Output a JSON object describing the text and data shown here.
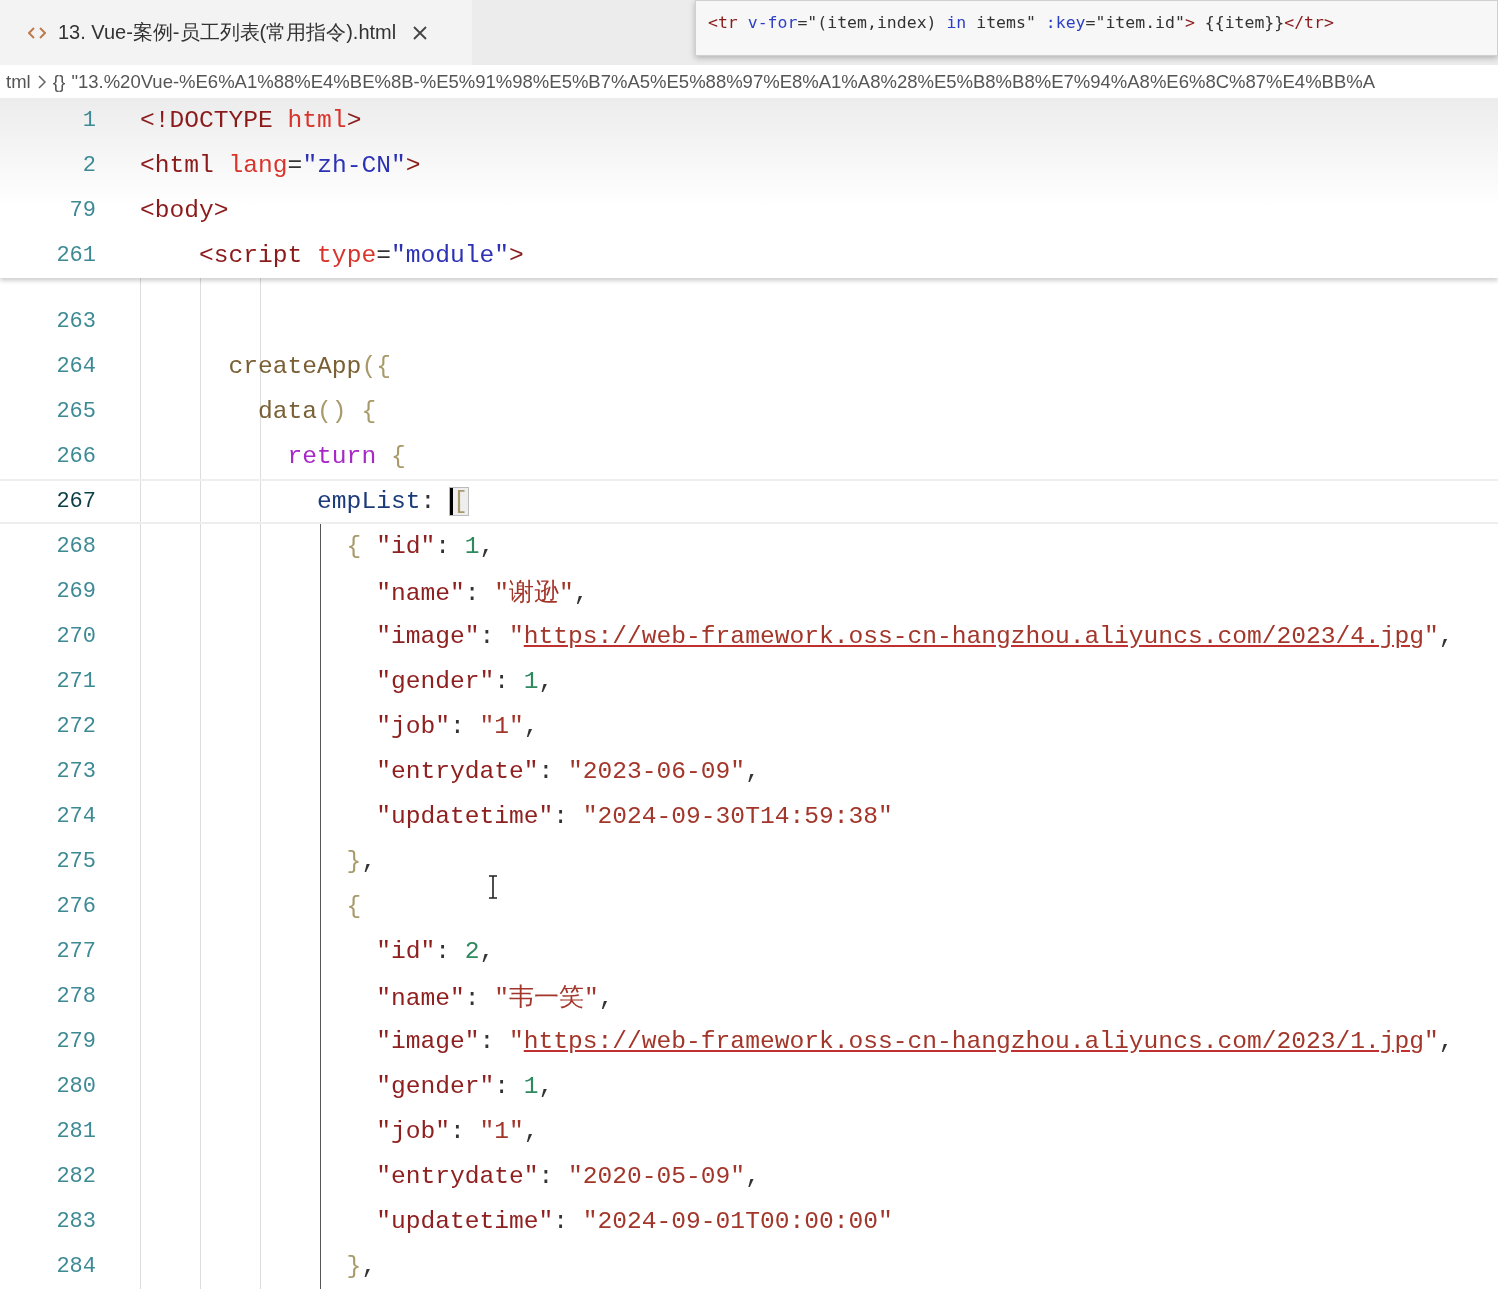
{
  "tab": {
    "title": "13. Vue-案例-员工列表(常用指令).html",
    "selected": true
  },
  "hover_preview": [
    {
      "kind": "tag",
      "text": "<tr"
    },
    {
      "kind": "attr",
      "text": " v-for"
    },
    {
      "kind": "punct",
      "text": "=\"(item,index) "
    },
    {
      "kind": "attr",
      "text": "in"
    },
    {
      "kind": "punct",
      "text": " items\" "
    },
    {
      "kind": "attr",
      "text": ":key"
    },
    {
      "kind": "punct",
      "text": "=\"item.id\""
    },
    {
      "kind": "tag",
      "text": ">"
    },
    {
      "kind": "punct",
      "text": " {{item}}"
    },
    {
      "kind": "tag",
      "text": "</tr>"
    }
  ],
  "breadcrumb": [
    {
      "kind": "text",
      "text": "tml"
    },
    {
      "kind": "symbol",
      "text": "{}"
    },
    {
      "kind": "text",
      "text": "\"13.%20Vue-%E6%A1%88%E4%BE%8B-%E5%91%98%E5%B7%A5%E5%88%97%E8%A1%A8%28%E5%B8%B8%E7%94%A8%E6%8C%87%E4%BB%A"
    }
  ],
  "sticky_lines": [
    {
      "number": "1",
      "tokens": [
        {
          "kind": "tag",
          "text": "<!DOCTYPE "
        },
        {
          "kind": "attr",
          "text": "html"
        },
        {
          "kind": "tag",
          "text": ">"
        }
      ]
    },
    {
      "number": "2",
      "tokens": [
        {
          "kind": "tag",
          "text": "<html "
        },
        {
          "kind": "attr",
          "text": "lang"
        },
        {
          "kind": "punct",
          "text": "="
        },
        {
          "kind": "attrval",
          "text": "\"zh-CN\""
        },
        {
          "kind": "tag",
          "text": ">"
        }
      ]
    },
    {
      "number": "79",
      "tokens": [
        {
          "kind": "tag",
          "text": "<body>"
        }
      ]
    },
    {
      "number": "261",
      "tokens": [
        {
          "kind": "tag",
          "text": "    <script "
        },
        {
          "kind": "attr",
          "text": "type"
        },
        {
          "kind": "punct",
          "text": "="
        },
        {
          "kind": "attrval",
          "text": "\"module\""
        },
        {
          "kind": "tag",
          "text": ">"
        }
      ]
    }
  ],
  "lines": [
    {
      "number": "263",
      "current": false
    },
    {
      "number": "264",
      "current": false,
      "tokens": [
        {
          "kind": "func",
          "text": "      createApp"
        },
        {
          "kind": "bracket",
          "text": "({"
        }
      ]
    },
    {
      "number": "265",
      "current": false,
      "tokens": [
        {
          "kind": "func",
          "text": "        data"
        },
        {
          "kind": "bracket",
          "text": "() {"
        }
      ]
    },
    {
      "number": "266",
      "current": false,
      "tokens": [
        {
          "kind": "kw",
          "text": "          return"
        },
        {
          "kind": "bracket",
          "text": " {"
        }
      ]
    },
    {
      "number": "267",
      "current": true,
      "tokens": [
        {
          "kind": "var",
          "text": "            empList"
        },
        {
          "kind": "punct",
          "text": ": "
        },
        {
          "kind": "cursor",
          "text": "["
        }
      ]
    },
    {
      "number": "268",
      "current": false,
      "tokens": [
        {
          "kind": "bracket",
          "text": "              { "
        },
        {
          "kind": "key",
          "text": "\"id\""
        },
        {
          "kind": "punct",
          "text": ": "
        },
        {
          "kind": "num",
          "text": "1"
        },
        {
          "kind": "punct",
          "text": ","
        }
      ]
    },
    {
      "number": "269",
      "current": false,
      "tokens": [
        {
          "kind": "key",
          "text": "                \"name\""
        },
        {
          "kind": "punct",
          "text": ": "
        },
        {
          "kind": "str",
          "text": "\"谢逊\""
        },
        {
          "kind": "punct",
          "text": ","
        }
      ]
    },
    {
      "number": "270",
      "current": false,
      "tokens": [
        {
          "kind": "key",
          "text": "                \"image\""
        },
        {
          "kind": "punct",
          "text": ": "
        },
        {
          "kind": "str",
          "text": "\""
        },
        {
          "kind": "link",
          "text": "https://web-framework.oss-cn-hangzhou.aliyuncs.com/2023/4.jpg"
        },
        {
          "kind": "str",
          "text": "\""
        },
        {
          "kind": "punct",
          "text": ","
        }
      ]
    },
    {
      "number": "271",
      "current": false,
      "tokens": [
        {
          "kind": "key",
          "text": "                \"gender\""
        },
        {
          "kind": "punct",
          "text": ": "
        },
        {
          "kind": "num",
          "text": "1"
        },
        {
          "kind": "punct",
          "text": ","
        }
      ]
    },
    {
      "number": "272",
      "current": false,
      "tokens": [
        {
          "kind": "key",
          "text": "                \"job\""
        },
        {
          "kind": "punct",
          "text": ": "
        },
        {
          "kind": "str",
          "text": "\"1\""
        },
        {
          "kind": "punct",
          "text": ","
        }
      ]
    },
    {
      "number": "273",
      "current": false,
      "tokens": [
        {
          "kind": "key",
          "text": "                \"entrydate\""
        },
        {
          "kind": "punct",
          "text": ": "
        },
        {
          "kind": "str",
          "text": "\"2023-06-09\""
        },
        {
          "kind": "punct",
          "text": ","
        }
      ]
    },
    {
      "number": "274",
      "current": false,
      "tokens": [
        {
          "kind": "key",
          "text": "                \"updatetime\""
        },
        {
          "kind": "punct",
          "text": ": "
        },
        {
          "kind": "str",
          "text": "\"2024-09-30T14:59:38\""
        }
      ]
    },
    {
      "number": "275",
      "current": false,
      "tokens": [
        {
          "kind": "bracket",
          "text": "              }"
        },
        {
          "kind": "punct",
          "text": ","
        }
      ]
    },
    {
      "number": "276",
      "current": false,
      "tokens": [
        {
          "kind": "bracket",
          "text": "              {"
        }
      ]
    },
    {
      "number": "277",
      "current": false,
      "tokens": [
        {
          "kind": "key",
          "text": "                \"id\""
        },
        {
          "kind": "punct",
          "text": ": "
        },
        {
          "kind": "num",
          "text": "2"
        },
        {
          "kind": "punct",
          "text": ","
        }
      ]
    },
    {
      "number": "278",
      "current": false,
      "tokens": [
        {
          "kind": "key",
          "text": "                \"name\""
        },
        {
          "kind": "punct",
          "text": ": "
        },
        {
          "kind": "str",
          "text": "\"韦一笑\""
        },
        {
          "kind": "punct",
          "text": ","
        }
      ]
    },
    {
      "number": "279",
      "current": false,
      "tokens": [
        {
          "kind": "key",
          "text": "                \"image\""
        },
        {
          "kind": "punct",
          "text": ": "
        },
        {
          "kind": "str",
          "text": "\""
        },
        {
          "kind": "link",
          "text": "https://web-framework.oss-cn-hangzhou.aliyuncs.com/2023/1.jpg"
        },
        {
          "kind": "str",
          "text": "\""
        },
        {
          "kind": "punct",
          "text": ","
        }
      ]
    },
    {
      "number": "280",
      "current": false,
      "tokens": [
        {
          "kind": "key",
          "text": "                \"gender\""
        },
        {
          "kind": "punct",
          "text": ": "
        },
        {
          "kind": "num",
          "text": "1"
        },
        {
          "kind": "punct",
          "text": ","
        }
      ]
    },
    {
      "number": "281",
      "current": false,
      "tokens": [
        {
          "kind": "key",
          "text": "                \"job\""
        },
        {
          "kind": "punct",
          "text": ": "
        },
        {
          "kind": "str",
          "text": "\"1\""
        },
        {
          "kind": "punct",
          "text": ","
        }
      ]
    },
    {
      "number": "282",
      "current": false,
      "tokens": [
        {
          "kind": "key",
          "text": "                \"entrydate\""
        },
        {
          "kind": "punct",
          "text": ": "
        },
        {
          "kind": "str",
          "text": "\"2020-05-09\""
        },
        {
          "kind": "punct",
          "text": ","
        }
      ]
    },
    {
      "number": "283",
      "current": false,
      "tokens": [
        {
          "kind": "key",
          "text": "                \"updatetime\""
        },
        {
          "kind": "punct",
          "text": ": "
        },
        {
          "kind": "str",
          "text": "\"2024-09-01T00:00:00\""
        }
      ]
    },
    {
      "number": "284",
      "current": false,
      "tokens": [
        {
          "kind": "bracket",
          "text": "              }"
        },
        {
          "kind": "punct",
          "text": ","
        }
      ]
    }
  ]
}
